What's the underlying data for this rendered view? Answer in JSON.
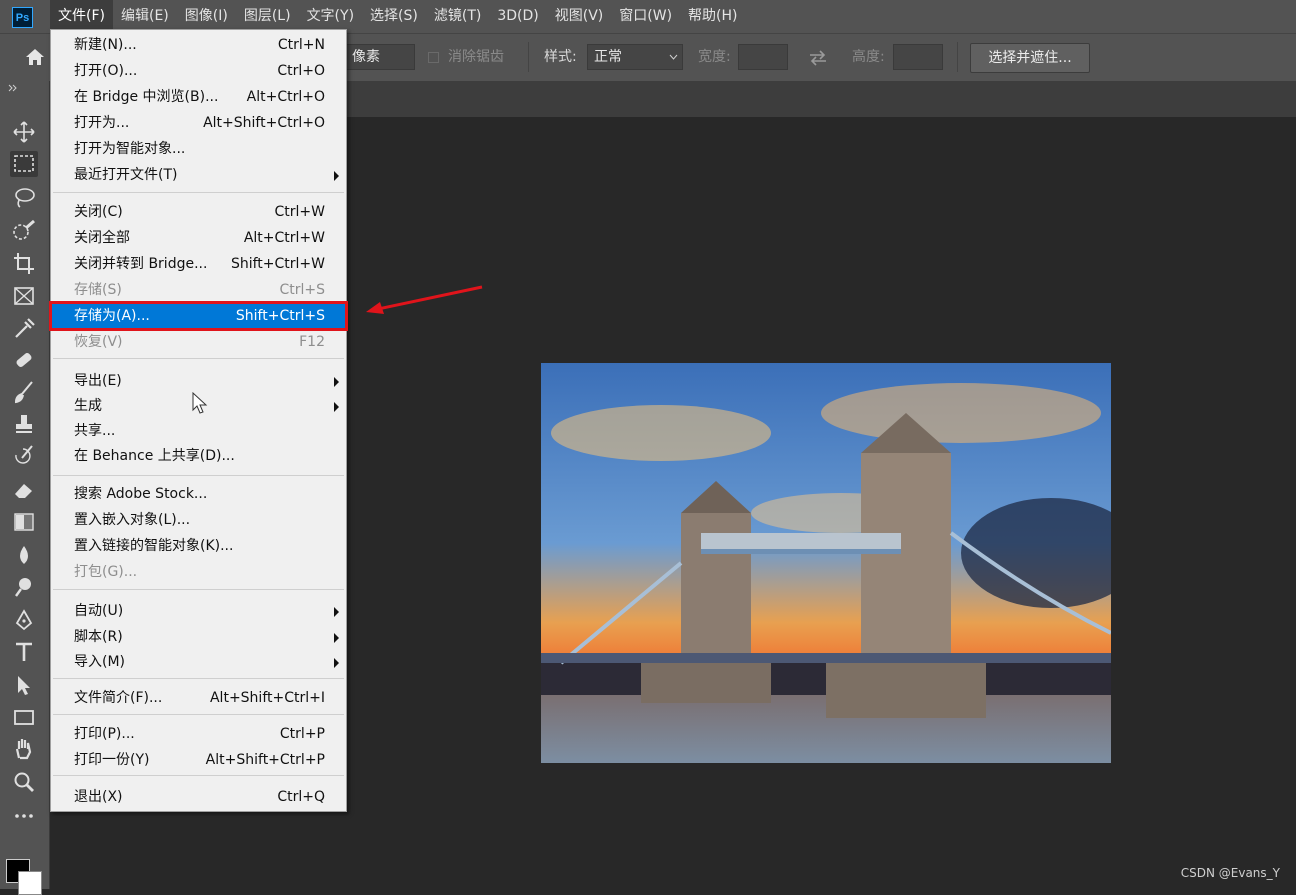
{
  "app": {
    "logo": "Ps"
  },
  "menubar": {
    "items": [
      "文件(F)",
      "编辑(E)",
      "图像(I)",
      "图层(L)",
      "文字(Y)",
      "选择(S)",
      "滤镜(T)",
      "3D(D)",
      "视图(V)",
      "窗口(W)",
      "帮助(H)"
    ],
    "active_index": 0
  },
  "options": {
    "feather_unit": "像素",
    "antialias_label": "消除锯齿",
    "style_label": "样式:",
    "style_value": "正常",
    "width_label": "宽度:",
    "height_label": "高度:",
    "select_mask_button": "选择并遮住..."
  },
  "file_menu": {
    "items": [
      {
        "label": "新建(N)...",
        "shortcut": "Ctrl+N"
      },
      {
        "label": "打开(O)...",
        "shortcut": "Ctrl+O"
      },
      {
        "label": "在 Bridge 中浏览(B)...",
        "shortcut": "Alt+Ctrl+O"
      },
      {
        "label": "打开为...",
        "shortcut": "Alt+Shift+Ctrl+O"
      },
      {
        "label": "打开为智能对象...",
        "shortcut": ""
      },
      {
        "label": "最近打开文件(T)",
        "shortcut": "",
        "submenu": true
      },
      {
        "label": "关闭(C)",
        "shortcut": "Ctrl+W"
      },
      {
        "label": "关闭全部",
        "shortcut": "Alt+Ctrl+W"
      },
      {
        "label": "关闭并转到 Bridge...",
        "shortcut": "Shift+Ctrl+W"
      },
      {
        "label": "存储(S)",
        "shortcut": "Ctrl+S",
        "disabled": true
      },
      {
        "label": "存储为(A)...",
        "shortcut": "Shift+Ctrl+S",
        "highlighted": true
      },
      {
        "label": "恢复(V)",
        "shortcut": "F12",
        "disabled": true
      },
      {
        "label": "导出(E)",
        "shortcut": "",
        "submenu": true
      },
      {
        "label": "生成",
        "shortcut": "",
        "submenu": true
      },
      {
        "label": "共享...",
        "shortcut": ""
      },
      {
        "label": "在 Behance 上共享(D)...",
        "shortcut": ""
      },
      {
        "label": "搜索 Adobe Stock...",
        "shortcut": ""
      },
      {
        "label": "置入嵌入对象(L)...",
        "shortcut": ""
      },
      {
        "label": "置入链接的智能对象(K)...",
        "shortcut": ""
      },
      {
        "label": "打包(G)...",
        "shortcut": "",
        "disabled": true
      },
      {
        "label": "自动(U)",
        "shortcut": "",
        "submenu": true
      },
      {
        "label": "脚本(R)",
        "shortcut": "",
        "submenu": true
      },
      {
        "label": "导入(M)",
        "shortcut": "",
        "submenu": true
      },
      {
        "label": "文件简介(F)...",
        "shortcut": "Alt+Shift+Ctrl+I"
      },
      {
        "label": "打印(P)...",
        "shortcut": "Ctrl+P"
      },
      {
        "label": "打印一份(Y)",
        "shortcut": "Alt+Shift+Ctrl+P"
      },
      {
        "label": "退出(X)",
        "shortcut": "Ctrl+Q"
      }
    ]
  },
  "tools": [
    "move-icon",
    "marquee-icon",
    "lasso-icon",
    "quick-select-icon",
    "crop-icon",
    "frame-icon",
    "eyedropper-icon",
    "healing-brush-icon",
    "brush-icon",
    "stamp-icon",
    "history-brush-icon",
    "eraser-icon",
    "gradient-icon",
    "blur-icon",
    "dodge-icon",
    "pen-icon",
    "type-icon",
    "path-select-icon",
    "rectangle-icon",
    "hand-icon",
    "zoom-icon",
    "more-tools-icon"
  ],
  "colors": {
    "highlight": "#0078d7",
    "annotation": "#e0141b",
    "foreground": "#000000",
    "background": "#ffffff"
  },
  "watermark": "CSDN @Evans_Y"
}
